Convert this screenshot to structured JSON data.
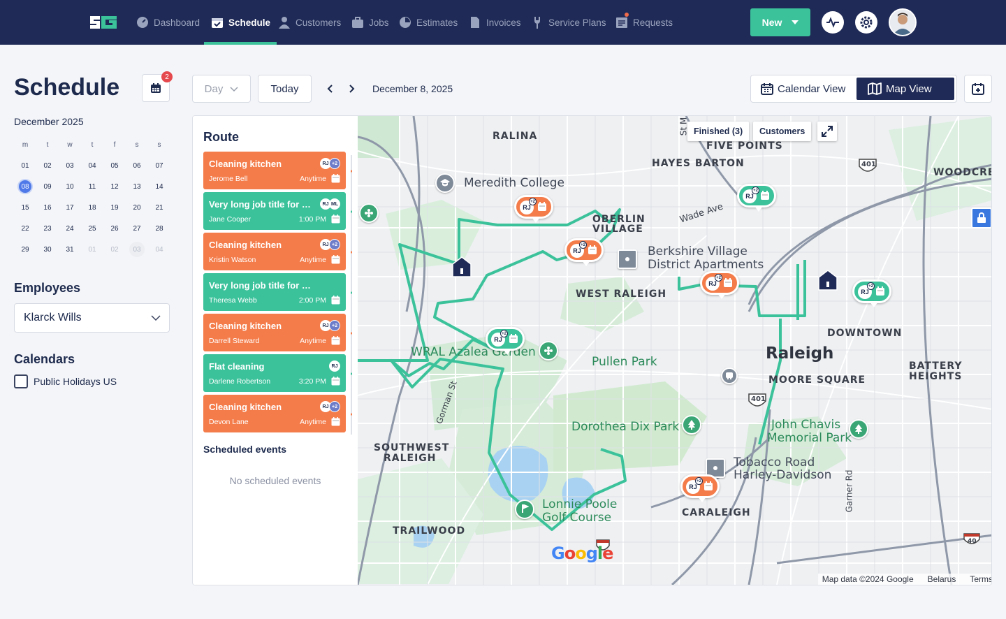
{
  "nav": {
    "items": [
      {
        "label": "Dashboard",
        "icon": "dashboard-icon"
      },
      {
        "label": "Schedule",
        "icon": "schedule-icon",
        "active": true
      },
      {
        "label": "Customers",
        "icon": "customers-icon"
      },
      {
        "label": "Jobs",
        "icon": "jobs-icon"
      },
      {
        "label": "Estimates",
        "icon": "estimates-icon"
      },
      {
        "label": "Invoices",
        "icon": "invoices-icon"
      },
      {
        "label": "Service Plans",
        "icon": "service-plans-icon"
      },
      {
        "label": "Requests",
        "icon": "requests-icon"
      }
    ],
    "new_label": "New",
    "accent": "#3cc29b",
    "bg": "#1f2a56"
  },
  "page": {
    "title": "Schedule",
    "calendar_badge": "2"
  },
  "mini_calendar": {
    "month": "December 2025",
    "weekdays": [
      "m",
      "t",
      "w",
      "t",
      "f",
      "s",
      "s"
    ],
    "days": [
      "01",
      "02",
      "03",
      "04",
      "05",
      "06",
      "07",
      "08",
      "09",
      "10",
      "11",
      "12",
      "13",
      "14",
      "15",
      "16",
      "17",
      "18",
      "19",
      "20",
      "21",
      "22",
      "23",
      "24",
      "25",
      "26",
      "27",
      "28",
      "29",
      "30",
      "31",
      "01",
      "02",
      "03",
      "04"
    ],
    "selected": "08"
  },
  "employees": {
    "heading": "Employees",
    "selected": "Klarck Wills"
  },
  "calendars": {
    "heading": "Calendars",
    "items": [
      "Public Holidays US"
    ]
  },
  "toolbar": {
    "view_select": "Day",
    "today": "Today",
    "date": "December 8, 2025",
    "calendar_view": "Calendar View",
    "map_view": "Map View"
  },
  "route": {
    "title": "Route",
    "jobs": [
      {
        "title": "Cleaning kitchen",
        "client": "Jerome Bell",
        "time": "Anytime",
        "color": "orange",
        "chips": [
          "RJ",
          "+2"
        ]
      },
      {
        "title": "Very long job title for the devs",
        "client": "Jane Cooper",
        "time": "1:00 PM",
        "color": "green",
        "chips": [
          "RJ",
          "ML"
        ]
      },
      {
        "title": "Cleaning kitchen",
        "client": "Kristin Watson",
        "time": "Anytime",
        "color": "orange",
        "chips": [
          "RJ",
          "+2"
        ]
      },
      {
        "title": "Very long job title for the devs",
        "client": "Theresa Webb",
        "time": "2:00 PM",
        "color": "green",
        "chips": []
      },
      {
        "title": "Cleaning kitchen",
        "client": "Darrell Steward",
        "time": "Anytime",
        "color": "orange",
        "chips": [
          "RJ",
          "+2"
        ]
      },
      {
        "title": "Flat cleaning",
        "client": "Darlene Robertson",
        "time": "3:20 PM",
        "color": "green",
        "chips": [
          "RJ"
        ]
      },
      {
        "title": "Cleaning kitchen",
        "client": "Devon Lane",
        "time": "Anytime",
        "color": "orange",
        "chips": [
          "RJ",
          "+2"
        ]
      }
    ],
    "scheduled_heading": "Scheduled events",
    "no_events": "No scheduled events"
  },
  "map": {
    "finished_btn": "Finished (3)",
    "customers_btn": "Customers",
    "labels": {
      "ralina": "RALINA",
      "five_points": "FIVE POINTS",
      "hayes_barton": "HAYES BARTON",
      "woodcrest": "WOODCREST",
      "meredith": "Meredith College",
      "oberlin": "OBERLIN",
      "village": "VILLAGE",
      "wade": "Wade Ave",
      "berkshire1": "Berkshire Village",
      "berkshire2": "District Apartments",
      "west_raleigh": "WEST RALEIGH",
      "downtown": "DOWNTOWN",
      "raleigh": "Raleigh",
      "battery1": "BATTERY",
      "battery2": "HEIGHTS",
      "moore": "MOORE SQUARE",
      "wral": "WRAL Azalea Garden",
      "pullen": "Pullen Park",
      "gorman": "Gorman St",
      "dorothea": "Dorothea Dix Park",
      "john1": "John Chavis",
      "john2": "Memorial Park",
      "sw1": "SOUTHWEST",
      "sw2": "RALEIGH",
      "tobacco1": "Tobacco Road",
      "tobacco2": "Harley-Davidson",
      "garner": "Garner Rd",
      "lonnie1": "Lonnie Poole",
      "lonnie2": "Golf Course",
      "caraleigh": "CARALEIGH",
      "trailwood": "TRAILWOOD",
      "st_m": "St M",
      "hwy401a": "401",
      "hwy401b": "401",
      "hwy40": "40"
    },
    "pins": [
      {
        "color": "orange",
        "initials": "RJ",
        "extra": "+2"
      },
      {
        "color": "orange",
        "initials": "RJ",
        "extra": "+2"
      },
      {
        "color": "orange",
        "initials": "RJ",
        "extra": "+2"
      },
      {
        "color": "green",
        "initials": "RJ",
        "extra": "+2"
      },
      {
        "color": "green",
        "initials": "RJ",
        "extra": "+2"
      },
      {
        "color": "green",
        "initials": "RJ",
        "extra": "+2"
      },
      {
        "color": "orange",
        "initials": "RJ",
        "extra": "+2"
      }
    ],
    "google": "Google",
    "attribution": {
      "data": "Map data ©2024 Google",
      "region": "Belarus",
      "terms": "Terms"
    },
    "route_color": "#3cc29b"
  }
}
